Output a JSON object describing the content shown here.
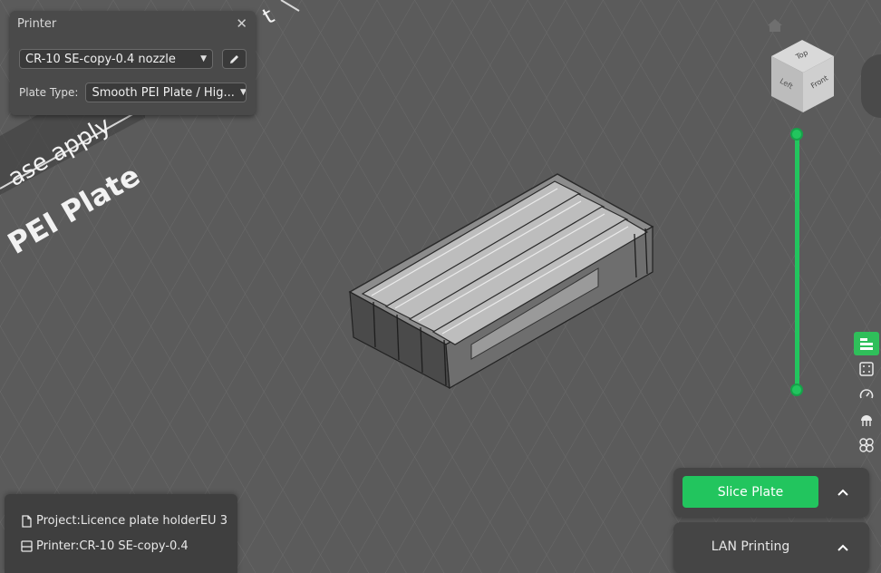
{
  "printer_panel": {
    "title": "Printer",
    "printer_select": "CR-10 SE-copy-0.4 nozzle",
    "plate_type_label": "Plate Type:",
    "plate_type_select": "Smooth PEI Plate / Hig..."
  },
  "bed_text": {
    "apply": "ase apply",
    "plate": "PEI Plate",
    "corner": "t"
  },
  "cube": {
    "top": "Top",
    "left": "Left",
    "front": "Front"
  },
  "info": {
    "project": "Project:Licence plate  holderEU 3",
    "printer": "Printer:CR-10 SE-copy-0.4"
  },
  "actions": {
    "slice": "Slice Plate",
    "lan": "LAN Printing"
  },
  "colors": {
    "accent": "#22c55e",
    "bed": "#5c5c5c",
    "panel": "#4a4a4a"
  }
}
